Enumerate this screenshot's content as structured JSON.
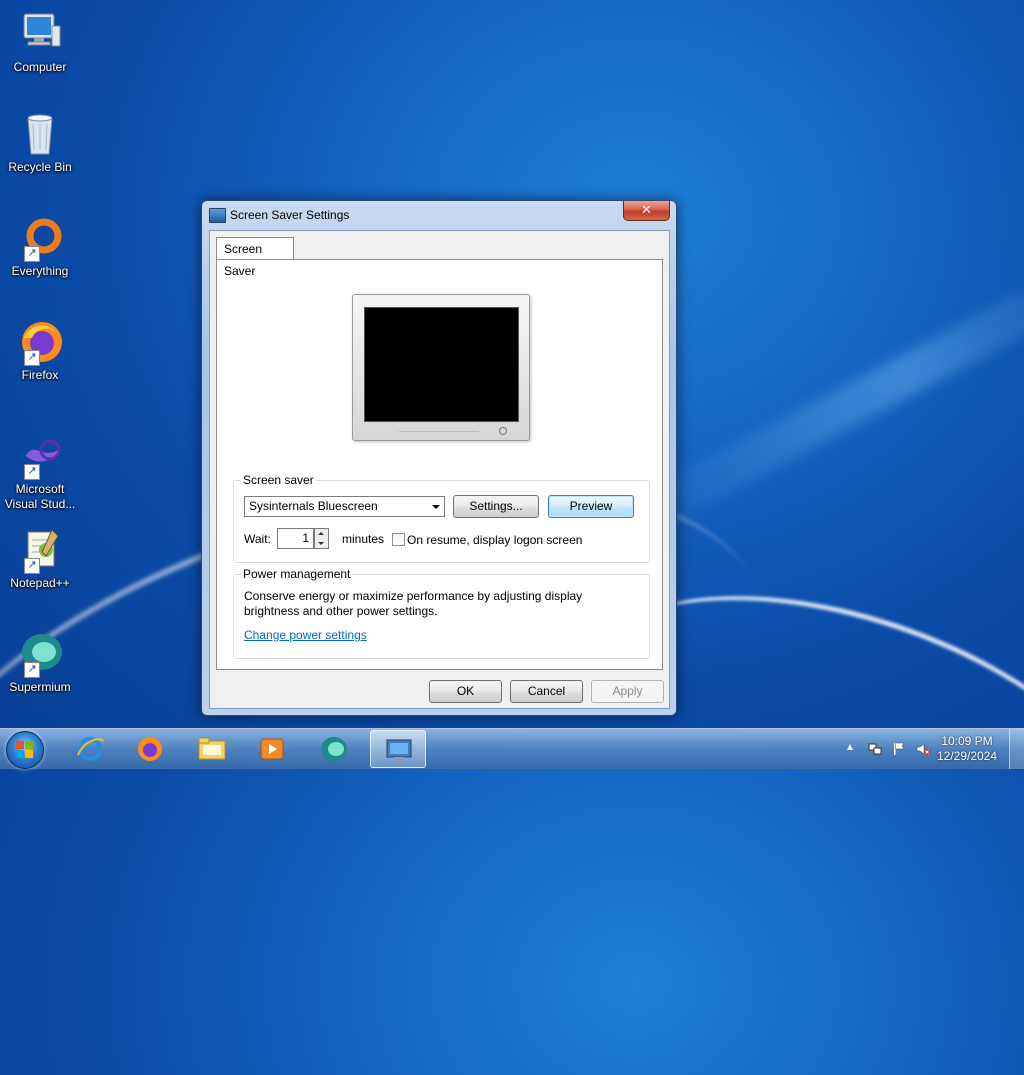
{
  "desktop": {
    "icons": [
      {
        "label": "Computer"
      },
      {
        "label": "Recycle Bin"
      },
      {
        "label": "Everything"
      },
      {
        "label": "Firefox"
      },
      {
        "label": "Microsoft\nVisual Stud..."
      },
      {
        "label": "Notepad++"
      },
      {
        "label": "Supermium"
      }
    ]
  },
  "dialog": {
    "title": "Screen Saver Settings",
    "close_glyph": "✕",
    "tab_label": "Screen Saver",
    "screen_saver_group": {
      "label": "Screen saver",
      "selected": "Sysinternals Bluescreen",
      "settings_button": "Settings...",
      "preview_button": "Preview",
      "wait_label": "Wait:",
      "wait_value": "1",
      "minutes_label": "minutes",
      "logon_checkbox_label": "On resume, display logon screen",
      "logon_checked": false
    },
    "power_group": {
      "label": "Power management",
      "description": "Conserve energy or maximize performance by adjusting display brightness and other power settings.",
      "link": "Change power settings"
    },
    "buttons": {
      "ok": "OK",
      "cancel": "Cancel",
      "apply": "Apply"
    }
  },
  "taskbar": {
    "pinned": [
      "start-button",
      "internet-explorer-icon",
      "firefox-icon",
      "file-explorer-icon",
      "media-player-icon",
      "supermium-icon",
      "screen-saver-settings-icon"
    ],
    "clock": {
      "time": "10:09 PM",
      "date": "12/29/2024"
    },
    "tray_icons": [
      "show-hidden-icons-arrow",
      "network-icon",
      "action-center-flag-icon",
      "volume-muted-icon"
    ]
  },
  "colors": {
    "desktop": "#1565c4",
    "dialog_frame": "#b9d1ee",
    "link": "#0066cc",
    "close_button": "#c03a22"
  }
}
